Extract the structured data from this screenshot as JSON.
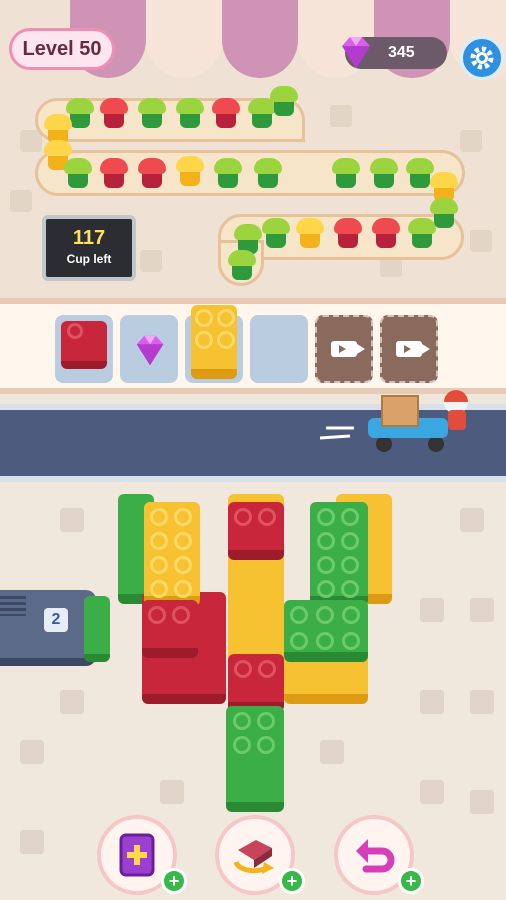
{
  "hud": {
    "level_label": "Level 50",
    "gems": "345"
  },
  "counter": {
    "cups_left": "117",
    "cups_left_label": "Cup left"
  },
  "slots": [
    {
      "state": "filled",
      "content": "red-brick"
    },
    {
      "state": "filled",
      "content": "gem"
    },
    {
      "state": "filled",
      "content": "yellow-brick"
    },
    {
      "state": "empty"
    },
    {
      "state": "locked",
      "icon": "video-ad-icon"
    },
    {
      "state": "locked",
      "icon": "video-ad-icon"
    }
  ],
  "bus": {
    "number": "2"
  },
  "cup_colors": [
    "green",
    "red",
    "yellow"
  ],
  "brick_colors": {
    "red": "#c8263a",
    "yellow": "#f6c232",
    "green": "#3cae48"
  },
  "bottom_buttons": [
    {
      "name": "add-slot-button",
      "icon": "card-plus-icon"
    },
    {
      "name": "shuffle-button",
      "icon": "shuffle-icon"
    },
    {
      "name": "undo-button",
      "icon": "undo-icon"
    }
  ],
  "colors": {
    "level_border": "#f08fb3",
    "settings": "#2f8fe0",
    "road": "#4d5b7e"
  }
}
